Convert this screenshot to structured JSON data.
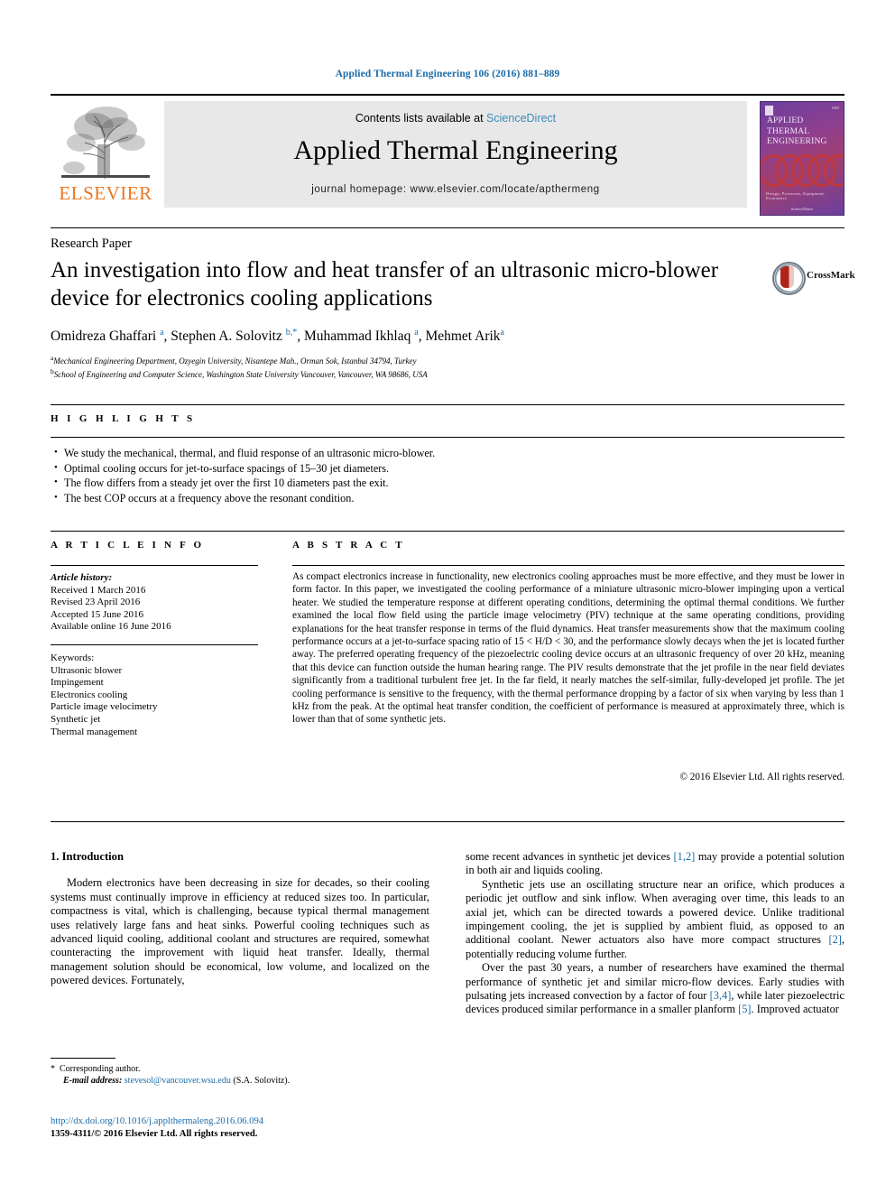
{
  "running_head": "Applied Thermal Engineering 106 (2016) 881–889",
  "masthead": {
    "contents_prefix": "Contents lists available at ",
    "sciencedirect": "ScienceDirect",
    "journal_title": "Applied Thermal Engineering",
    "homepage": "journal homepage: www.elsevier.com/locate/apthermeng",
    "publisher_name": "ELSEVIER",
    "cover": {
      "title": "Applied Thermal Engineering",
      "footer": "Design, Processes, Equipment, Economics",
      "footer2": "ScienceDirect"
    }
  },
  "article": {
    "kicker": "Research Paper",
    "title": "An investigation into flow and heat transfer of an ultrasonic micro-blower device for electronics cooling applications",
    "crossmark_label": "CrossMark",
    "authors_html": "Omidreza Ghaffari <sup>a</sup>, Stephen A. Solovitz <sup>b,*</sup>, Muhammad Ikhlaq <sup>a</sup>, Mehmet Arik<sup>a</sup>",
    "affiliations": [
      {
        "marker": "a",
        "text": "Mechanical Engineering Department, Ozyegin University, Nisantepe Mah., Orman Sok, Istanbul 34794, Turkey"
      },
      {
        "marker": "b",
        "text": "School of Engineering and Computer Science, Washington State University Vancouver, Vancouver, WA 98686, USA"
      }
    ]
  },
  "highlights": {
    "heading": "H I G H L I G H T S",
    "items": [
      "We study the mechanical, thermal, and fluid response of an ultrasonic micro-blower.",
      "Optimal cooling occurs for jet-to-surface spacings of 15–30 jet diameters.",
      "The flow differs from a steady jet over the first 10 diameters past the exit.",
      "The best COP occurs at a frequency above the resonant condition."
    ]
  },
  "article_info": {
    "heading": "A R T I C L E   I N F O",
    "history_label": "Article history:",
    "history": [
      "Received 1 March 2016",
      "Revised 23 April 2016",
      "Accepted 15 June 2016",
      "Available online 16 June 2016"
    ],
    "keywords_label": "Keywords:",
    "keywords": [
      "Ultrasonic blower",
      "Impingement",
      "Electronics cooling",
      "Particle image velocimetry",
      "Synthetic jet",
      "Thermal management"
    ]
  },
  "abstract": {
    "heading": "A B S T R A C T",
    "text": "As compact electronics increase in functionality, new electronics cooling approaches must be more effective, and they must be lower in form factor. In this paper, we investigated the cooling performance of a miniature ultrasonic micro-blower impinging upon a vertical heater. We studied the temperature response at different operating conditions, determining the optimal thermal conditions. We further examined the local flow field using the particle image velocimetry (PIV) technique at the same operating conditions, providing explanations for the heat transfer response in terms of the fluid dynamics. Heat transfer measurements show that the maximum cooling performance occurs at a jet-to-surface spacing ratio of 15 < H/D < 30, and the performance slowly decays when the jet is located further away. The preferred operating frequency of the piezoelectric cooling device occurs at an ultrasonic frequency of over 20 kHz, meaning that this device can function outside the human hearing range. The PIV results demonstrate that the jet profile in the near field deviates significantly from a traditional turbulent free jet. In the far field, it nearly matches the self-similar, fully-developed jet profile. The jet cooling performance is sensitive to the frequency, with the thermal performance dropping by a factor of six when varying by less than 1 kHz from the peak. At the optimal heat transfer condition, the coefficient of performance is measured at approximately three, which is lower than that of some synthetic jets.",
    "copyright": "© 2016 Elsevier Ltd. All rights reserved."
  },
  "body": {
    "section_title": "1. Introduction",
    "left_paragraphs": [
      "Modern electronics have been decreasing in size for decades, so their cooling systems must continually improve in efficiency at reduced sizes too. In particular, compactness is vital, which is challenging, because typical thermal management uses relatively large fans and heat sinks. Powerful cooling techniques such as advanced liquid cooling, additional coolant and structures are required, somewhat counteracting the improvement with liquid heat transfer. Ideally, thermal management solution should be economical, low volume, and localized on the powered devices. Fortunately,"
    ],
    "right_paragraphs": [
      {
        "indent": false,
        "parts": [
          {
            "text": "some recent advances in synthetic jet devices "
          },
          {
            "text": "[1,2]",
            "ref": true
          },
          {
            "text": " may provide a potential solution in both air and liquids cooling."
          }
        ]
      },
      {
        "indent": true,
        "parts": [
          {
            "text": "Synthetic jets use an oscillating structure near an orifice, which produces a periodic jet outflow and sink inflow. When averaging over time, this leads to an axial jet, which can be directed towards a powered device. Unlike traditional impingement cooling, the jet is supplied by ambient fluid, as opposed to an additional coolant. Newer actuators also have more compact structures "
          },
          {
            "text": "[2]",
            "ref": true
          },
          {
            "text": ", potentially reducing volume further."
          }
        ]
      },
      {
        "indent": true,
        "parts": [
          {
            "text": "Over the past 30 years, a number of researchers have examined the thermal performance of synthetic jet and similar micro-flow devices. Early studies with pulsating jets increased convection by a factor of four "
          },
          {
            "text": "[3,4]",
            "ref": true
          },
          {
            "text": ", while later piezoelectric devices produced similar performance in a smaller planform "
          },
          {
            "text": "[5]",
            "ref": true
          },
          {
            "text": ". Improved actuator"
          }
        ]
      }
    ]
  },
  "footer": {
    "corresponding_marker": "*",
    "corresponding_text": "Corresponding author.",
    "email_label": "E-mail address:",
    "email": "stevesol@vancouver.wsu.edu",
    "email_owner": "(S.A. Solovitz).",
    "doi": "http://dx.doi.org/10.1016/j.applthermaleng.2016.06.094",
    "issn_line": "1359-4311/© 2016 Elsevier Ltd. All rights reserved."
  },
  "colors": {
    "link": "#1b6ca8",
    "elsevier_orange": "#e87722",
    "band_gray": "#e8e8e8"
  }
}
